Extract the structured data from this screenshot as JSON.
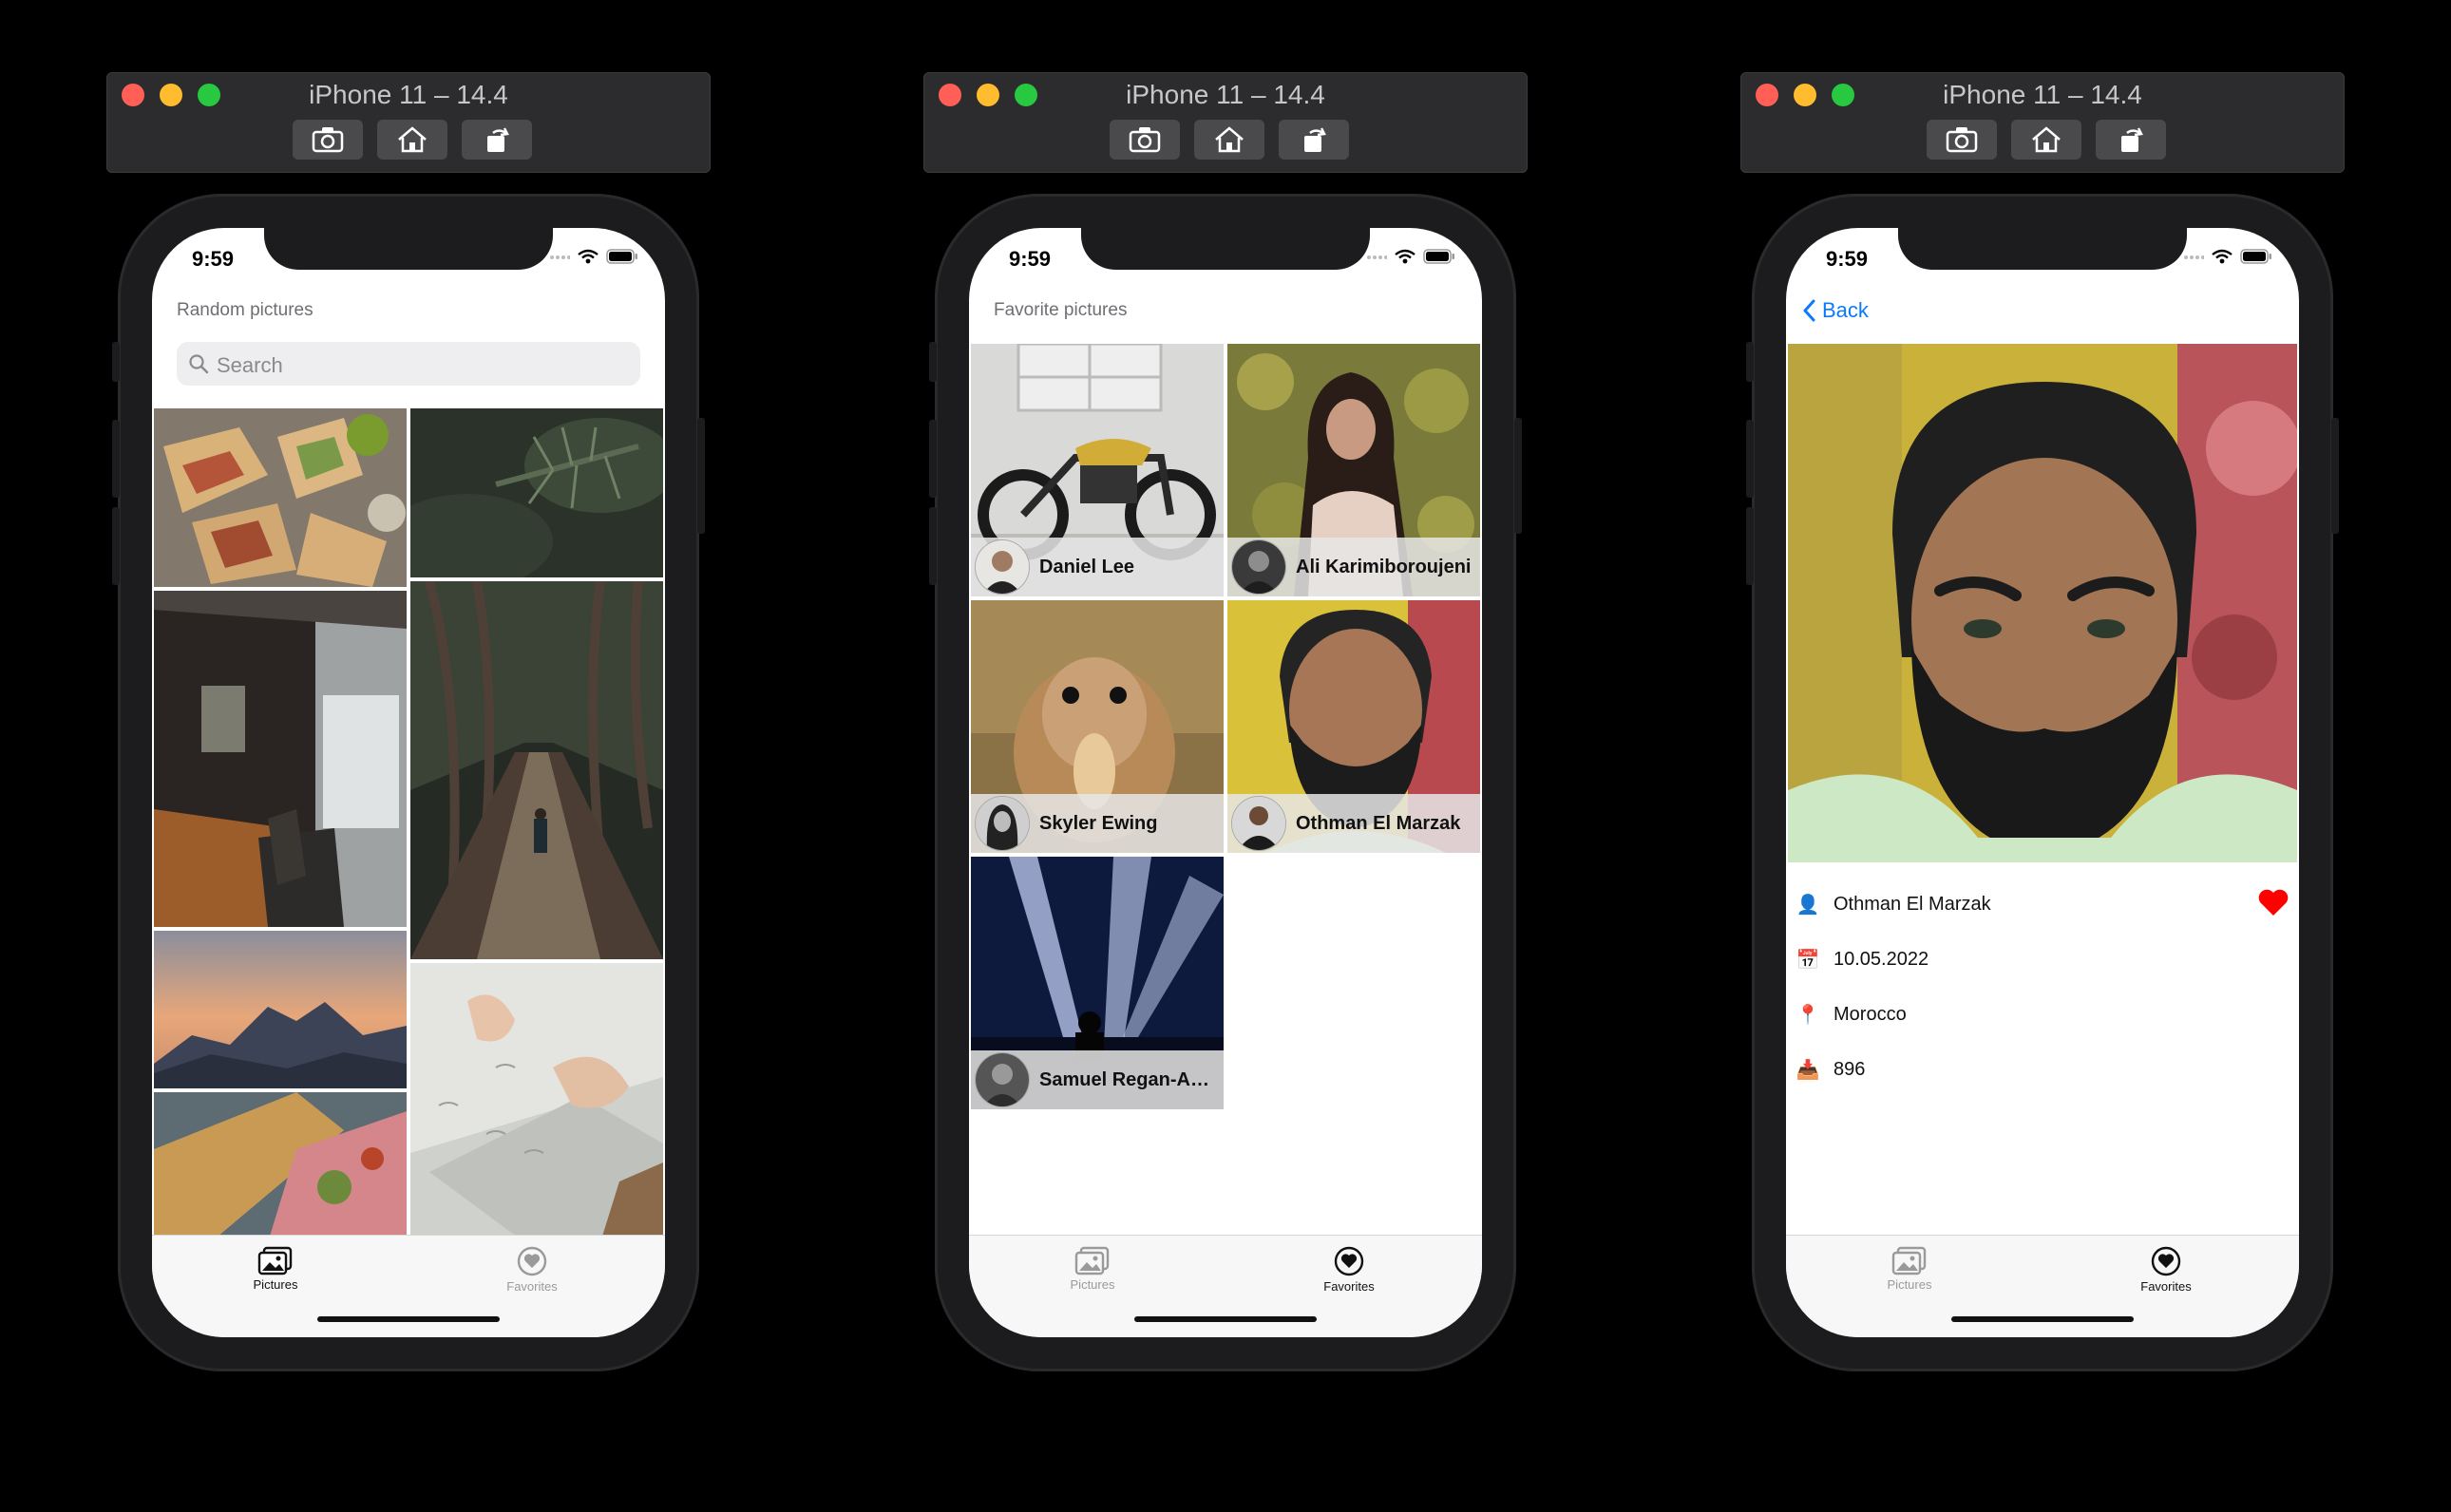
{
  "simulator": {
    "title": "iPhone 11 – 14.4",
    "buttons": [
      "screenshot",
      "home",
      "rotate"
    ]
  },
  "status_bar": {
    "time": "9:59"
  },
  "tabs": {
    "pictures": "Pictures",
    "favorites": "Favorites"
  },
  "screen1": {
    "title": "Random pictures",
    "search_placeholder": "Search",
    "photos": [
      "wraps-food",
      "pine-branch",
      "dark-interior",
      "tree-tunnel-road",
      "mountain-sunset",
      "paper-hands",
      "cutting-board"
    ]
  },
  "screen2": {
    "title": "Favorite pictures",
    "cells": [
      {
        "name": "Daniel Lee",
        "photo": "motorcycle"
      },
      {
        "name": "Ali Karimiboroujeni",
        "photo": "woman-flowers"
      },
      {
        "name": "Skyler Ewing",
        "photo": "chipmunk"
      },
      {
        "name": "Othman El Marzak",
        "photo": "bearded-man"
      },
      {
        "name": "Samuel Regan-Asa...",
        "photo": "concert"
      }
    ]
  },
  "screen3": {
    "back_label": "Back",
    "author": "Othman El Marzak",
    "date": "10.05.2022",
    "location": "Morocco",
    "downloads": "896",
    "favorited": true
  },
  "colors": {
    "accent": "#0a7aff",
    "heart": "#ff0000",
    "active_tab": "#111111",
    "inactive_tab": "#9a9a9a"
  }
}
